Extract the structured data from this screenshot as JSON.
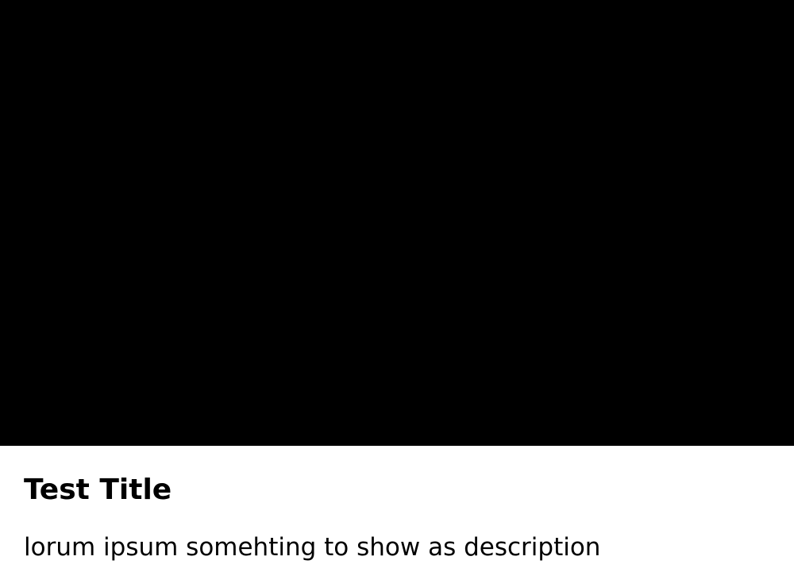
{
  "card": {
    "title": "Test Title",
    "description": "lorum ipsum somehting to show as description",
    "media_color": "#000000"
  }
}
